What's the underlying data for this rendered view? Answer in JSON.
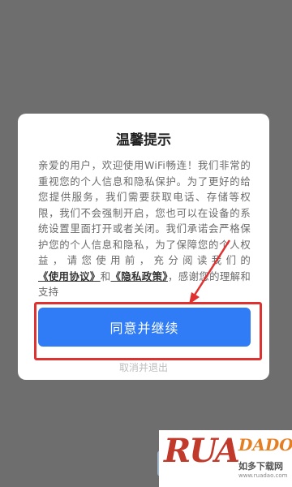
{
  "dialog": {
    "title": "温馨提示",
    "body_part1": "亲爱的用户，欢迎使用WiFi畅连！我们非常的重视您的个人信息和隐私保护。为了更好的给您提供服务，我们需要获取电话、存储等权限，我们不会强制开启，您也可以在设备的系统设置里面打开或者关闭。我们承诺会严格保护您的个人信息和隐私，为了保障您的个人权益，请您使用前，充分阅读我们的",
    "link_terms": "《使用协议》",
    "and_word": "和",
    "link_privacy": "《隐私政策》",
    "body_part2": "，感谢您的理解和支持",
    "agree_button": "同意并继续",
    "cancel_link": "取消并退出"
  },
  "colors": {
    "accent": "#2f7cf6",
    "annotation": "#e03131"
  },
  "watermark": {
    "logo_big": "RUA",
    "logo_small": "DADO",
    "text": "如多下载网",
    "url": "www.ruadao.com"
  }
}
